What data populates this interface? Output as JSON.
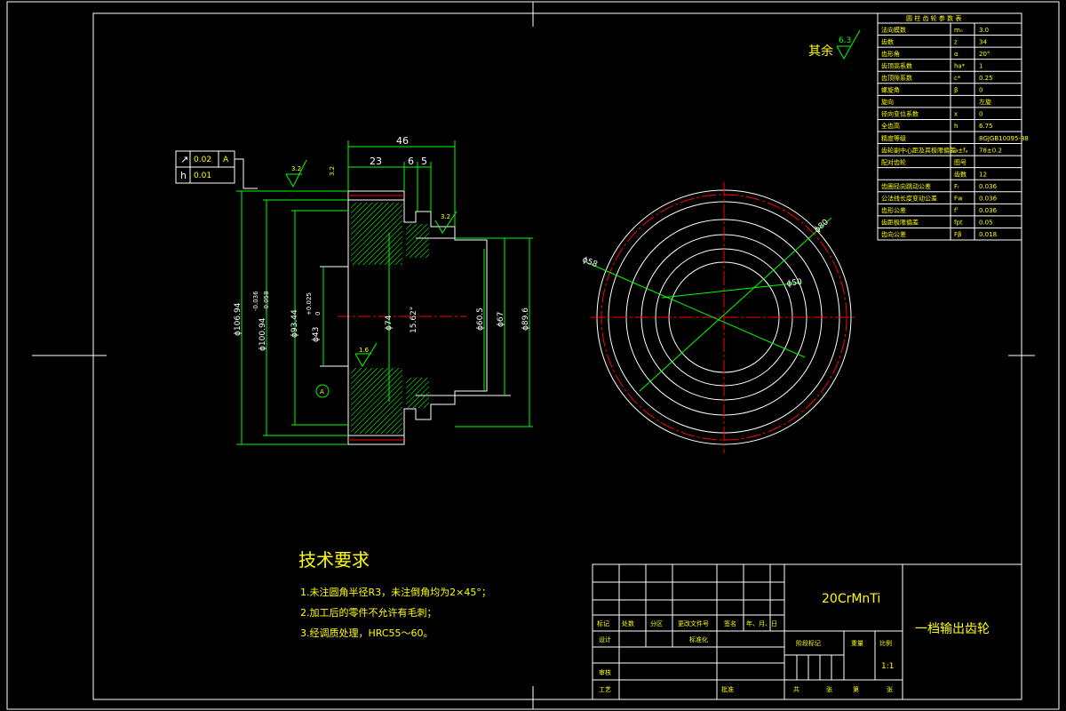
{
  "surface_finish_note": {
    "label": "其余",
    "value": "6.3"
  },
  "gear_table": {
    "title": "圆 柱 齿 轮 参 数 表",
    "rows": [
      {
        "name": "法向模数",
        "symbol": "mₙ",
        "value": "3.0"
      },
      {
        "name": "齿数",
        "symbol": "z",
        "value": "34"
      },
      {
        "name": "齿形角",
        "symbol": "α",
        "value": "20°"
      },
      {
        "name": "齿顶高系数",
        "symbol": "ha*",
        "value": "1"
      },
      {
        "name": "齿顶隙系数",
        "symbol": "c*",
        "value": "0.25"
      },
      {
        "name": "螺旋角",
        "symbol": "β",
        "value": "0"
      },
      {
        "name": "旋向",
        "symbol": "",
        "value": "左旋"
      },
      {
        "name": "径向变位系数",
        "symbol": "x",
        "value": "0"
      },
      {
        "name": "全齿高",
        "symbol": "h",
        "value": "6.75"
      },
      {
        "name": "精度等级",
        "symbol": "",
        "value": "8GJGB10095-88"
      },
      {
        "name": "齿轮副中心距及其极限偏差",
        "symbol": "a±fₐ",
        "value": "78±0.2"
      },
      {
        "name": "配对齿轮",
        "symbol": "图号",
        "value": ""
      },
      {
        "name": "",
        "symbol": "齿数",
        "value": "12"
      },
      {
        "name": "齿圈径向跳动公差",
        "symbol": "Fᵣ",
        "value": "0.036"
      },
      {
        "name": "公法线长度变动公差",
        "symbol": "Fw",
        "value": "0.036"
      },
      {
        "name": "齿形公差",
        "symbol": "fᶠ",
        "value": "0.036"
      },
      {
        "name": "齿距极限偏差",
        "symbol": "fpt",
        "value": "0.05"
      },
      {
        "name": "齿向公差",
        "symbol": "Fβ",
        "value": "0.018"
      }
    ]
  },
  "tolerance_frame": {
    "rows": [
      {
        "symbol": "↗",
        "value": "0.02",
        "datum": "A"
      },
      {
        "symbol": "h",
        "value": "0.01",
        "datum": ""
      }
    ]
  },
  "datum_label": "A",
  "dimensions": {
    "top_width": "46",
    "top_left": "23",
    "top_mid_a": "6",
    "top_mid_b": "5",
    "rough_top": "3.2",
    "rough_top2": "3.2",
    "rough_right": "3.2",
    "rough_lower": "1.6",
    "d_outer": "ϕ106.94",
    "d_root": "ϕ100.94",
    "d_root_tol_upper": "-0.036",
    "d_root_tol_lower": "-0.058",
    "d_pitch": "ϕ93.44",
    "d_bore": "ϕ43",
    "d_bore_tol_upper": "+0.025",
    "d_bore_tol_lower": "0",
    "d_74": "ϕ74",
    "d_15": "15.62°",
    "d_605": "ϕ60.5",
    "d_67": "ϕ67",
    "d_896": "ϕ89.6",
    "side_d58": "ϕ58",
    "side_d80": "ϕ80",
    "side_d50": "ϕ50"
  },
  "tech_requirements": {
    "title": "技术要求",
    "items": [
      "1.未注圆角半径R3，未注倒角均为2×45°；",
      "2.加工后的零件不允许有毛刺；",
      "3.经调质处理，HRC55～60。"
    ]
  },
  "title_block": {
    "material": "20CrMnTi",
    "part_name": "一档输出齿轮",
    "row_labels": [
      "标记",
      "处数",
      "分区",
      "更改文件号",
      "签名",
      "年、月、日"
    ],
    "design": "设计",
    "standardization": "标准化",
    "review": "审核",
    "process": "工艺",
    "approve": "批准",
    "stage_mark": "阶段标记",
    "weight": "重量",
    "scale_label": "比例",
    "scale": "1:1",
    "sheets_total": "共",
    "sheets_unit": "张",
    "sheet_no": "第",
    "sheet_unit2": "张"
  }
}
